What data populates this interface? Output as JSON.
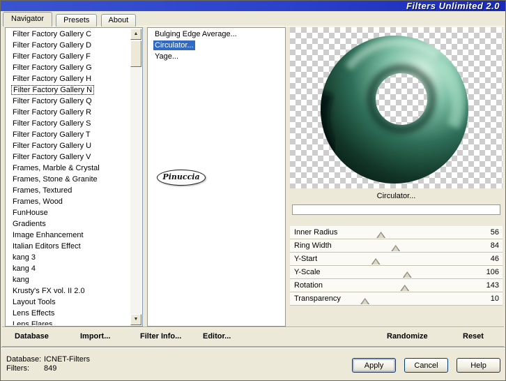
{
  "window": {
    "title": "Filters Unlimited 2.0"
  },
  "tabs": [
    "Navigator",
    "Presets",
    "About"
  ],
  "categories": {
    "selected": "Filter Factory Gallery N",
    "items": [
      "Filter Factory Gallery C",
      "Filter Factory Gallery D",
      "Filter Factory Gallery F",
      "Filter Factory Gallery G",
      "Filter Factory Gallery H",
      "Filter Factory Gallery N",
      "Filter Factory Gallery Q",
      "Filter Factory Gallery R",
      "Filter Factory Gallery S",
      "Filter Factory Gallery T",
      "Filter Factory Gallery U",
      "Filter Factory Gallery V",
      "Frames, Marble & Crystal",
      "Frames, Stone & Granite",
      "Frames, Textured",
      "Frames, Wood",
      "FunHouse",
      "Gradients",
      "Image Enhancement",
      "Italian Editors Effect",
      "kang 3",
      "kang 4",
      "kang",
      "Krusty's FX vol. II 2.0",
      "Layout Tools",
      "Lens Effects",
      "Lens Flares"
    ]
  },
  "filters": {
    "selected": "Circulator...",
    "items": [
      "Bulging Edge Average...",
      "Circulator...",
      "Yage..."
    ]
  },
  "logo": {
    "text": "Pinuccia"
  },
  "preview": {
    "filter_label": "Circulator...",
    "progress_percent": 0
  },
  "params": [
    {
      "label": "Inner Radius",
      "value": 56,
      "max": 255
    },
    {
      "label": "Ring Width",
      "value": 84,
      "max": 255
    },
    {
      "label": "Y-Start",
      "value": 46,
      "max": 255
    },
    {
      "label": "Y-Scale",
      "value": 106,
      "max": 255
    },
    {
      "label": "Rotation",
      "value": 143,
      "max": 360
    },
    {
      "label": "Transparency",
      "value": 10,
      "max": 100
    }
  ],
  "actions": {
    "database": "Database",
    "import": "Import...",
    "filter_info": "Filter Info...",
    "editor": "Editor...",
    "randomize": "Randomize",
    "reset": "Reset"
  },
  "status": {
    "database_label": "Database:",
    "database_value": "ICNET-Filters",
    "filters_label": "Filters:",
    "filters_value": "849"
  },
  "buttons": {
    "apply": "Apply",
    "cancel": "Cancel",
    "help": "Help"
  },
  "scrollbar": {
    "up_glyph": "▲",
    "down_glyph": "▼"
  },
  "colors": {
    "selection": "#316ac5",
    "titlebar_left": "#3a54d0",
    "titlebar_right": "#1a2ab8",
    "dialog_bg": "#ece9d8",
    "donut_light": "#d2f4e2",
    "donut_dark": "#04100a"
  }
}
